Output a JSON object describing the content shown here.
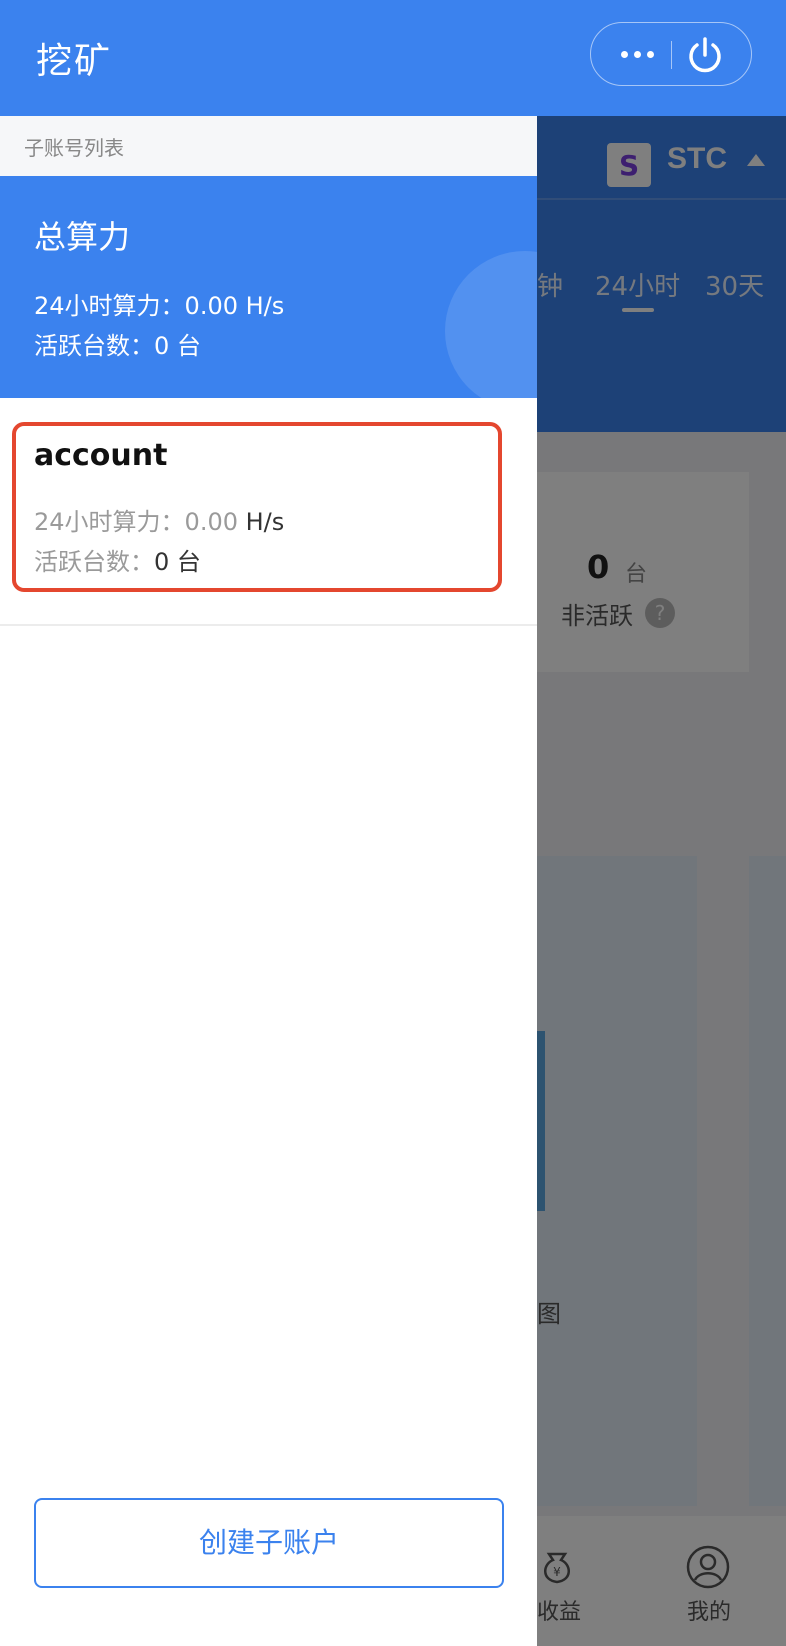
{
  "header": {
    "title": "挖矿",
    "more_icon": "more-dots-icon",
    "power_icon": "power-icon"
  },
  "drawer": {
    "section_label": "子账号列表",
    "total": {
      "title": "总算力",
      "hashrate_label": "24小时算力：",
      "hashrate_value": "0.00 H/s",
      "active_label": "活跃台数：",
      "active_value": "0 台"
    },
    "account": {
      "name": "account",
      "hashrate_label": "24小时算力：",
      "hashrate_num": "0.00",
      "hashrate_unit": "H/s",
      "active_label": "活跃台数：",
      "active_value": "0 台"
    },
    "create_button": "创建子账户"
  },
  "background": {
    "coin": "STC",
    "time_tabs": [
      "钟",
      "24小时",
      "30天"
    ],
    "inactive_count": "0",
    "inactive_unit": "台",
    "inactive_label": "非活跃",
    "help_glyph": "?",
    "partial_text": "图",
    "tabbar": {
      "income_label": "收益",
      "me_label": "我的"
    }
  },
  "colors": {
    "primary": "#3b82ee",
    "highlight_border": "#e4472f",
    "overlay": "rgba(0,0,0,0.5)"
  }
}
